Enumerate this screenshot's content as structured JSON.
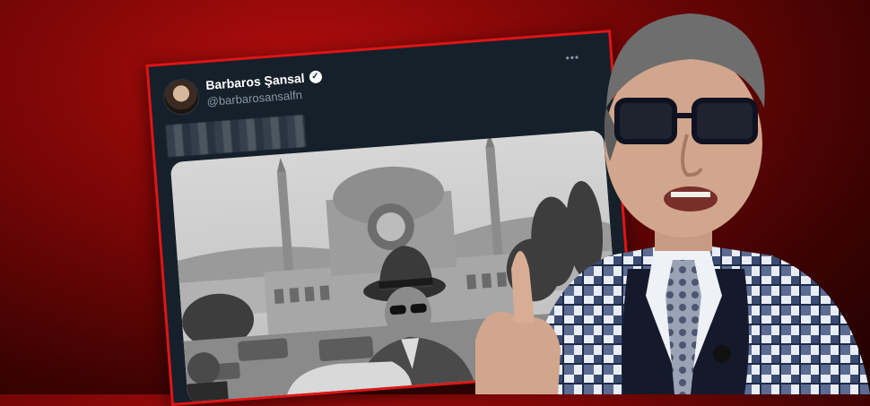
{
  "tweet": {
    "display_name": "Barbaros Şansal",
    "handle": "@barbarosansalfn",
    "verified": true,
    "more_icon": "more-horizontal-icon",
    "text_obscured": true
  },
  "colors": {
    "background": "#7a0606",
    "frame_highlight": "#e01414",
    "tweet_background": "#15202b",
    "handle_text": "#8899a6"
  }
}
